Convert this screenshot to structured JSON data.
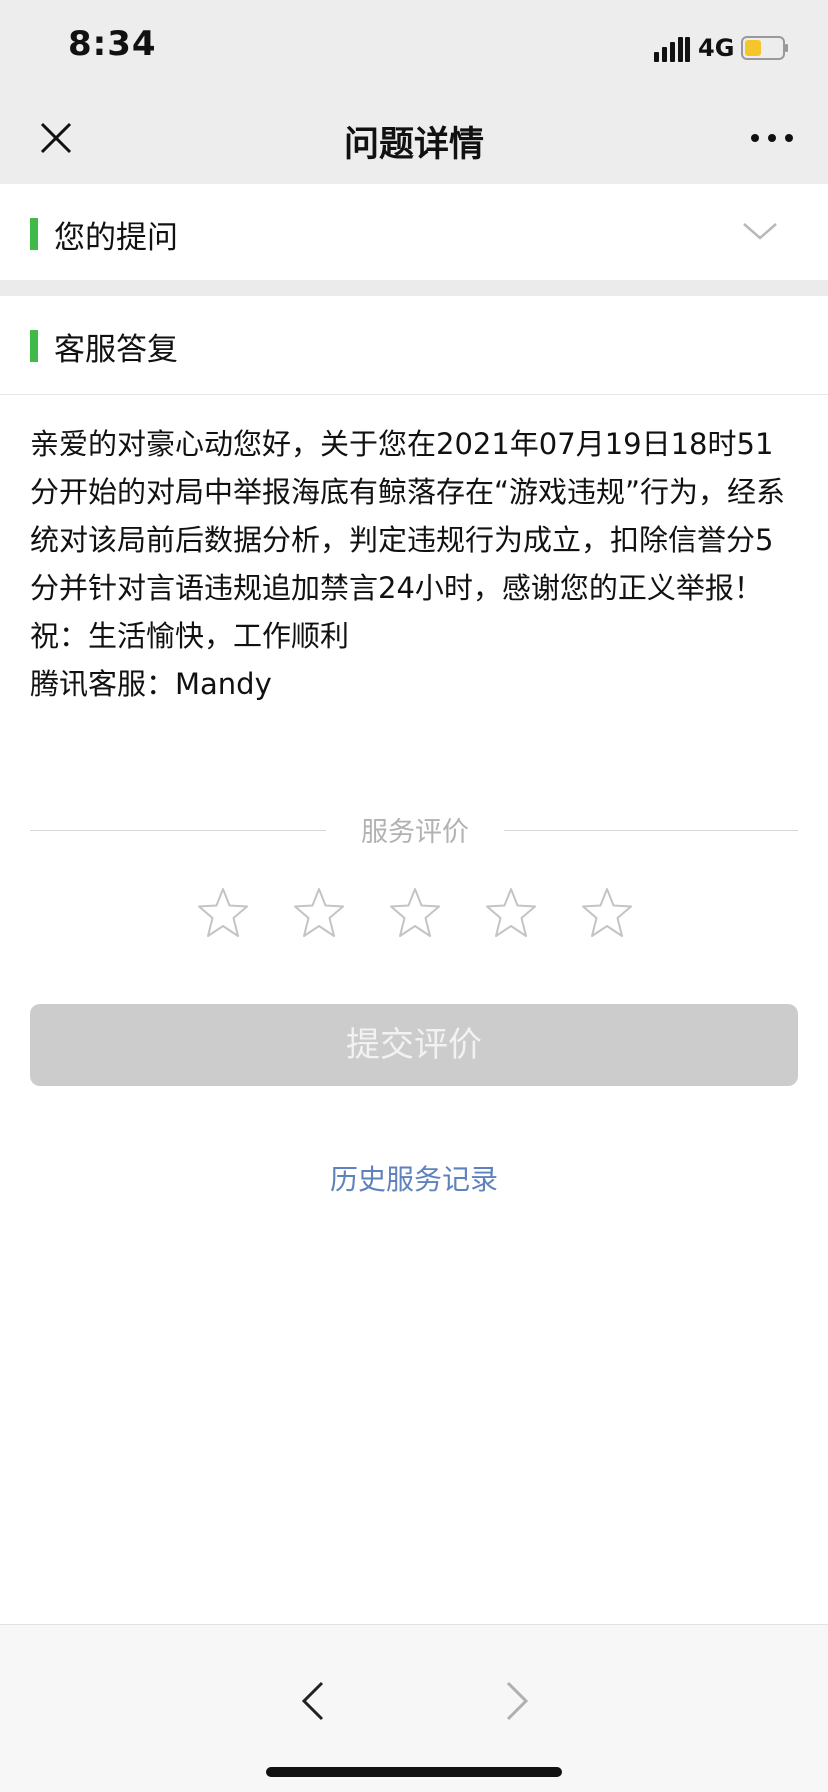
{
  "status_bar": {
    "time": "8:34",
    "network": "4G",
    "signal_icon": "signal-bars-icon",
    "battery_icon": "battery-low-icon",
    "battery_color": "#f5c52c"
  },
  "nav": {
    "title": "问题详情",
    "close_icon": "close-icon",
    "more_icon": "more-dots-icon"
  },
  "sections": {
    "question": {
      "label": "您的提问",
      "expand_icon": "chevron-down-icon"
    },
    "reply": {
      "label": "客服答复",
      "paragraphs": [
        "亲爱的对豪心动您好，关于您在2021年07月19日18时51分开始的对局中举报海底有鲸落存在“游戏违规”行为，经系统对该局前后数据分析，判定违规行为成立，扣除信誉分5分并针对言语违规追加禁言24小时，感谢您的正义举报！",
        "祝：生活愉快，工作顺利",
        "腾讯客服：Mandy"
      ]
    }
  },
  "rating": {
    "title": "服务评价",
    "star_count": 5,
    "selected": 0,
    "submit_label": "提交评价"
  },
  "history_link": "历史服务记录",
  "toolbar": {
    "back_icon": "chevron-left-icon",
    "forward_icon": "chevron-right-icon"
  },
  "colors": {
    "accent_green": "#3fb94a",
    "link_blue": "#5f82bd",
    "disabled_button": "#cccccc",
    "header_bg": "#ededed"
  }
}
